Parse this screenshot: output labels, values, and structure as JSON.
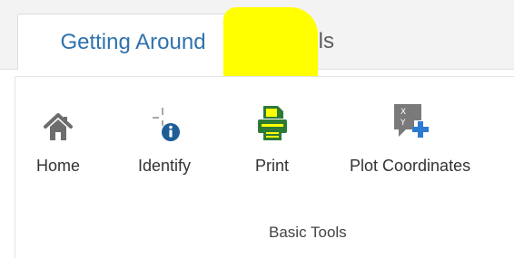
{
  "tabs": [
    {
      "label": "Getting Around",
      "active": true
    },
    {
      "label": "Tools",
      "active": false
    }
  ],
  "tools": [
    {
      "label": "Home",
      "icon": "home-icon"
    },
    {
      "label": "Identify",
      "icon": "identify-icon"
    },
    {
      "label": "Print",
      "icon": "printer-icon",
      "highlighted": true
    },
    {
      "label": "Plot Coordinates",
      "icon": "plot-coordinates-icon"
    }
  ],
  "group": {
    "label": "Basic Tools"
  },
  "colors": {
    "active_tab_text": "#2f72ad",
    "home_icon": "#6d6d6d",
    "identify_badge": "#1f5d97",
    "print_icon": "#2d7a36",
    "plot_icon": "#7a7a7a",
    "plot_plus": "#2c7bd0",
    "highlight": "#ffff00"
  }
}
